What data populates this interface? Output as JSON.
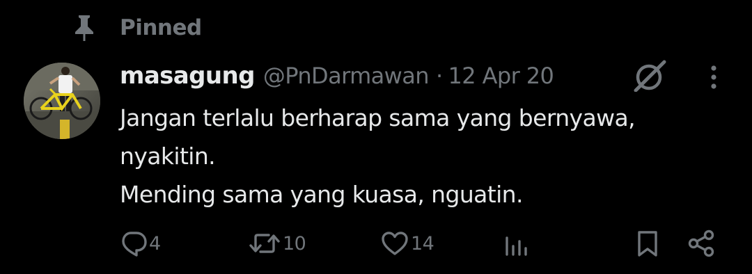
{
  "pinned": {
    "icon": "pin-icon",
    "label": "Pinned"
  },
  "author": {
    "avatar": "avatar-photo",
    "display_name": "masagung",
    "handle": "@PnDarmawan",
    "separator": "·",
    "date": "12 Apr 20"
  },
  "header_icons": {
    "grok": "grok-icon",
    "more": "more-icon"
  },
  "tweet": {
    "lines": [
      "Jangan terlalu berharap sama yang bernyawa,",
      "nyakitin.",
      "Mending sama yang kuasa, nguatin."
    ]
  },
  "actions": {
    "reply": {
      "icon": "reply-icon",
      "count": "4"
    },
    "retweet": {
      "icon": "retweet-icon",
      "count": "10"
    },
    "like": {
      "icon": "heart-icon",
      "count": "14"
    },
    "views": {
      "icon": "analytics-icon"
    },
    "bookmark": {
      "icon": "bookmark-icon"
    },
    "share": {
      "icon": "share-icon"
    }
  },
  "colors": {
    "background": "#000000",
    "primary_text": "#e7e9ea",
    "secondary_text": "#71767b"
  }
}
